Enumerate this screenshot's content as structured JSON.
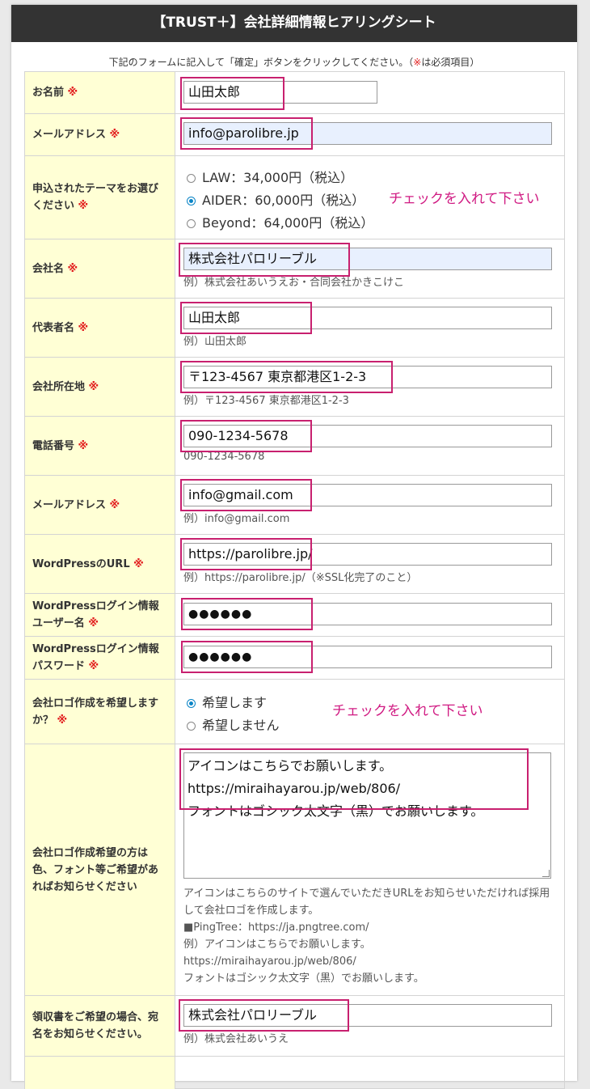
{
  "header": {
    "title": "【TRUST＋】会社詳細情報ヒアリングシート"
  },
  "intro": {
    "text": "下記のフォームに記入して「確定」ボタンをクリックしてください。（",
    "mark": "※",
    "tail": "は必須項目）"
  },
  "req_mark": "※",
  "rows": {
    "name": {
      "label": "お名前",
      "value": "山田太郎"
    },
    "mail1": {
      "label": "メールアドレス",
      "value": "info@parolibre.jp"
    },
    "theme": {
      "label": "申込されたテーマをお選びください",
      "options": [
        "LAW：34,000円（税込）",
        "AIDER：60,000円（税込）",
        "Beyond：64,000円（税込）"
      ],
      "selected_index": 1,
      "annotation": "チェックを入れて下さい"
    },
    "company": {
      "label": "会社名",
      "value": "株式会社パロリーブル",
      "hint": "例）株式会社あいうえお・合同会社かきこけこ"
    },
    "rep": {
      "label": "代表者名",
      "value": "山田太郎",
      "hint": "例）山田太郎"
    },
    "address": {
      "label": "会社所在地",
      "value": "〒123-4567 東京都港区1-2-3",
      "hint": "例）〒123-4567 東京都港区1-2-3"
    },
    "tel": {
      "label": "電話番号",
      "value": "090-1234-5678",
      "hint": "090-1234-5678"
    },
    "mail2": {
      "label": "メールアドレス",
      "value": "info@gmail.com",
      "hint": "例）info@gmail.com"
    },
    "wpurl": {
      "label": "WordPressのURL",
      "value": "https://parolibre.jp/",
      "hint": "例）https://parolibre.jp/（※SSL化完了のこと）"
    },
    "wpuser": {
      "label1": "WordPressログイン情報",
      "label2": "ユーザー名",
      "value": "●●●●●●"
    },
    "wppass": {
      "label1": "WordPressログイン情報",
      "label2": "パスワード",
      "value": "●●●●●●"
    },
    "logo": {
      "label": "会社ロゴ作成を希望しますか？",
      "options": [
        "希望します",
        "希望しません"
      ],
      "selected_index": 0,
      "annotation": "チェックを入れて下さい"
    },
    "logo_detail": {
      "label": "会社ロゴ作成希望の方は色、フォント等ご希望があればお知らせください",
      "lines": [
        "アイコンはこちらでお願いします。",
        "https://miraihayarou.jp/web/806/",
        "フォントはゴシック太文字（黒）でお願いします。"
      ],
      "note": [
        "アイコンはこちらのサイトで選んでいただきURLをお知らせいただければ採用して会社ロゴを作成します。",
        "■PingTree：https://ja.pngtree.com/",
        "例）アイコンはこちらでお願いします。",
        "https://miraihayarou.jp/web/806/",
        "フォントはゴシック太文字（黒）でお願いします。"
      ]
    },
    "receipt": {
      "label": "領収書をご希望の場合、宛名をお知らせください。",
      "value": "株式会社パロリーブル",
      "hint": "例）株式会社あいうえ"
    }
  }
}
